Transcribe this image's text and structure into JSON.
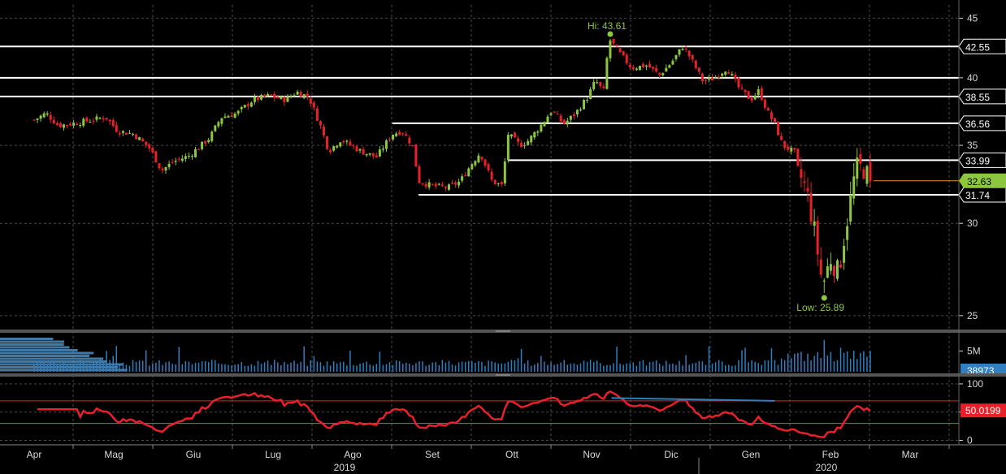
{
  "colors": {
    "background": "#000000",
    "grid": "#4a4a4a",
    "up": "#8dc63f",
    "down": "#e8202a",
    "level_line": "#ffffff",
    "volume": "#2f7fc1",
    "rsi": "#e8202a",
    "rsi_upper": "#e8202a",
    "rsi_lower": "#20c020",
    "trendline": "#2f7fc1",
    "current_price": "#8dc63f",
    "axis_text": "#d8d8d8",
    "divider": "#888888"
  },
  "chart_data": [
    {
      "type": "candlestick",
      "panel": "price",
      "y_scale": "log",
      "ylim": [
        24.4,
        46.2
      ],
      "y_ticks": [
        25,
        30,
        35,
        40,
        45
      ],
      "grid": true,
      "x": [
        "Apr",
        "Mag",
        "Giu",
        "Lug",
        "Ago",
        "Set",
        "Ott",
        "Nov",
        "Dic",
        "Gen",
        "Feb",
        "Mar"
      ],
      "ohlc_anchors": [
        {
          "m": 0.0,
          "c": 36.8
        },
        {
          "m": 0.15,
          "c": 37.3
        },
        {
          "m": 0.3,
          "c": 36.4
        },
        {
          "m": 0.55,
          "c": 36.6
        },
        {
          "m": 0.9,
          "c": 37.0
        },
        {
          "m": 1.05,
          "c": 36.0
        },
        {
          "m": 1.25,
          "c": 35.8
        },
        {
          "m": 1.45,
          "c": 34.8
        },
        {
          "m": 1.6,
          "c": 33.3
        },
        {
          "m": 1.75,
          "c": 33.9
        },
        {
          "m": 1.95,
          "c": 34.3
        },
        {
          "m": 2.2,
          "c": 35.5
        },
        {
          "m": 2.35,
          "c": 37.0
        },
        {
          "m": 2.55,
          "c": 37.3
        },
        {
          "m": 2.75,
          "c": 38.3
        },
        {
          "m": 2.95,
          "c": 38.6
        },
        {
          "m": 3.15,
          "c": 38.3
        },
        {
          "m": 3.3,
          "c": 38.9
        },
        {
          "m": 3.45,
          "c": 38.5
        },
        {
          "m": 3.6,
          "c": 36.3
        },
        {
          "m": 3.7,
          "c": 34.6
        },
        {
          "m": 3.85,
          "c": 35.4
        },
        {
          "m": 4.1,
          "c": 34.6
        },
        {
          "m": 4.3,
          "c": 34.2
        },
        {
          "m": 4.5,
          "c": 35.8
        },
        {
          "m": 4.62,
          "c": 36.0
        },
        {
          "m": 4.75,
          "c": 35.0
        },
        {
          "m": 4.83,
          "c": 32.6
        },
        {
          "m": 5.0,
          "c": 32.3
        },
        {
          "m": 5.2,
          "c": 32.2
        },
        {
          "m": 5.35,
          "c": 32.6
        },
        {
          "m": 5.5,
          "c": 33.8
        },
        {
          "m": 5.6,
          "c": 34.5
        },
        {
          "m": 5.75,
          "c": 32.6
        },
        {
          "m": 5.88,
          "c": 32.3
        },
        {
          "m": 5.95,
          "c": 35.8
        },
        {
          "m": 6.1,
          "c": 35.0
        },
        {
          "m": 6.2,
          "c": 35.3
        },
        {
          "m": 6.35,
          "c": 36.3
        },
        {
          "m": 6.5,
          "c": 37.5
        },
        {
          "m": 6.65,
          "c": 36.5
        },
        {
          "m": 6.8,
          "c": 37.3
        },
        {
          "m": 6.95,
          "c": 38.5
        },
        {
          "m": 7.05,
          "c": 39.8
        },
        {
          "m": 7.15,
          "c": 38.9
        },
        {
          "m": 7.22,
          "c": 43.2
        },
        {
          "m": 7.35,
          "c": 42.0
        },
        {
          "m": 7.5,
          "c": 40.8
        },
        {
          "m": 7.7,
          "c": 41.0
        },
        {
          "m": 7.85,
          "c": 40.2
        },
        {
          "m": 8.0,
          "c": 41.2
        },
        {
          "m": 8.15,
          "c": 42.6
        },
        {
          "m": 8.25,
          "c": 41.5
        },
        {
          "m": 8.4,
          "c": 39.7
        },
        {
          "m": 8.55,
          "c": 40.0
        },
        {
          "m": 8.7,
          "c": 40.8
        },
        {
          "m": 8.85,
          "c": 39.2
        },
        {
          "m": 9.0,
          "c": 38.3
        },
        {
          "m": 9.1,
          "c": 39.0
        },
        {
          "m": 9.2,
          "c": 37.5
        },
        {
          "m": 9.3,
          "c": 36.5
        },
        {
          "m": 9.4,
          "c": 35.0
        },
        {
          "m": 9.55,
          "c": 34.5
        },
        {
          "m": 9.6,
          "c": 33.2
        },
        {
          "m": 9.7,
          "c": 32.0
        },
        {
          "m": 9.8,
          "c": 29.5
        },
        {
          "m": 9.9,
          "c": 26.5
        },
        {
          "m": 10.0,
          "c": 28.0
        },
        {
          "m": 10.1,
          "c": 27.2
        },
        {
          "m": 10.22,
          "c": 30.5
        },
        {
          "m": 10.32,
          "c": 33.5
        },
        {
          "m": 10.42,
          "c": 33.4
        },
        {
          "m": 10.5,
          "c": 32.63
        }
      ],
      "high": {
        "label": "Hi: 43.61",
        "value": 43.61
      },
      "low": {
        "label": "Low: 25.89",
        "value": 25.89
      },
      "levels": [
        {
          "value": 42.55,
          "label": "42.55",
          "from_m": 0
        },
        {
          "value": 40.0,
          "label": "",
          "from_m": 0
        },
        {
          "value": 38.55,
          "label": "38.55",
          "from_m": 0
        },
        {
          "value": 36.56,
          "label": "36.56",
          "from_m": 4.5
        },
        {
          "value": 33.99,
          "label": "33.99",
          "from_m": 5.95
        },
        {
          "value": 31.74,
          "label": "31.74",
          "from_m": 4.83
        }
      ],
      "last_price": {
        "value": 32.63,
        "label": "32.63"
      }
    },
    {
      "type": "bar",
      "panel": "volume",
      "y_ticks": [
        {
          "value": 5000000,
          "label": "5M"
        }
      ],
      "last_value_label": "38973",
      "grid": true
    },
    {
      "type": "line",
      "panel": "rsi",
      "ylim": [
        -5,
        110
      ],
      "y_ticks": [
        0,
        50,
        100
      ],
      "upper_band": 70,
      "lower_band": 30,
      "last_value_label": "50.0199",
      "grid": true
    }
  ],
  "x_axis": {
    "months": [
      "Apr",
      "Mag",
      "Giu",
      "Lug",
      "Ago",
      "Set",
      "Ott",
      "Nov",
      "Dic",
      "Gen",
      "Feb",
      "Mar"
    ],
    "years": [
      {
        "label": "2019",
        "at_m": 4.0
      },
      {
        "label": "2020",
        "at_m": 10.05
      }
    ]
  }
}
